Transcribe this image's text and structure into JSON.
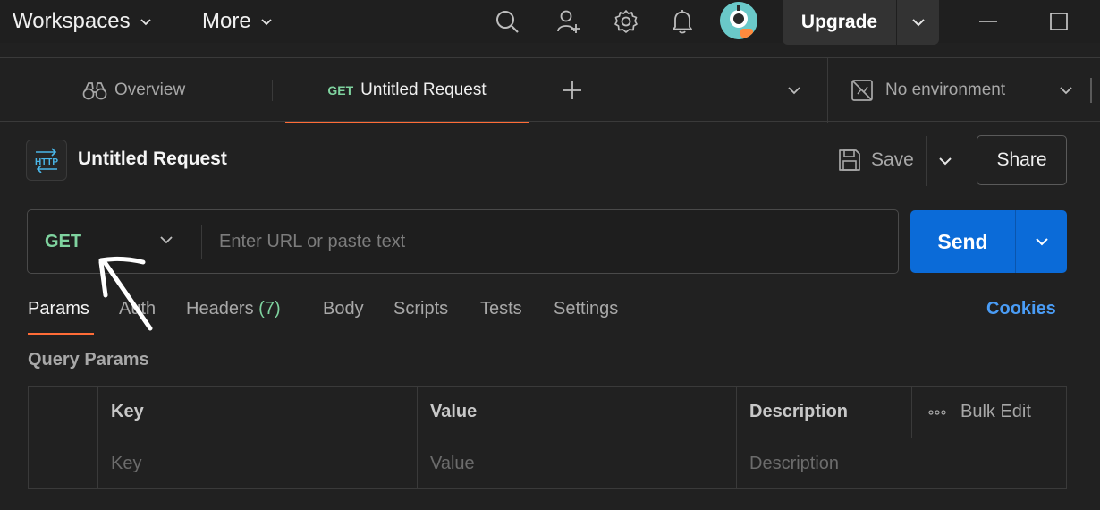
{
  "topbar": {
    "workspaces_label": "Workspaces",
    "more_label": "More",
    "upgrade_label": "Upgrade",
    "icons": [
      "search-icon",
      "invite-user-icon",
      "settings-icon",
      "notifications-icon",
      "avatar"
    ]
  },
  "tabs": {
    "overview_label": "Overview",
    "active_method": "GET",
    "active_label": "Untitled Request",
    "environment_label": "No environment"
  },
  "request": {
    "icon_text": "HTTP",
    "title": "Untitled Request",
    "save_label": "Save",
    "share_label": "Share",
    "method": "GET",
    "url_placeholder": "Enter URL or paste text",
    "send_label": "Send"
  },
  "subtabs": {
    "params": "Params",
    "auth": "Auth",
    "headers": "Headers",
    "headers_count": "(7)",
    "body": "Body",
    "scripts": "Scripts",
    "tests": "Tests",
    "settings": "Settings",
    "cookies": "Cookies"
  },
  "query_params": {
    "title": "Query Params",
    "columns": [
      "Key",
      "Value",
      "Description"
    ],
    "bulk_edit": "Bulk Edit",
    "placeholders": [
      "Key",
      "Value",
      "Description"
    ]
  },
  "colors": {
    "background": "#212121",
    "accent_orange": "#ff6c37",
    "method_green": "#7fd39f",
    "send_blue": "#0b6bd8",
    "link_blue": "#4a9cf5"
  }
}
